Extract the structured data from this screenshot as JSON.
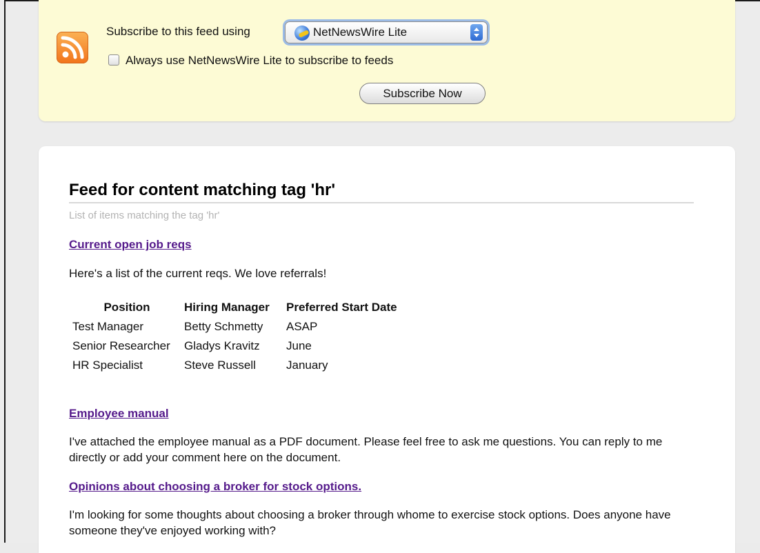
{
  "subscribe": {
    "label": "Subscribe to this feed using",
    "reader": "NetNewsWire Lite",
    "always_label": "Always use NetNewsWire Lite to subscribe to feeds",
    "always_checked": false,
    "button_label": "Subscribe Now"
  },
  "feed": {
    "title": "Feed for content matching tag 'hr'",
    "subtitle": "List of items matching the tag 'hr'",
    "items": [
      {
        "title": "Current open job reqs",
        "text": "Here's a list of the current reqs. We love referrals!"
      },
      {
        "title": "Employee manual",
        "text": "I've attached the employee manual as a PDF document. Please feel free to ask me questions. You can reply to me directly or add your comment here on the document."
      },
      {
        "title": "Opinions about choosing a broker for stock options.",
        "text": "I'm looking for some thoughts about choosing a broker through whome to exercise stock options. Does anyone have someone they've enjoyed working with?"
      }
    ],
    "table": {
      "headers": [
        "Position",
        "Hiring Manager",
        "Preferred Start Date"
      ],
      "rows": [
        [
          "Test Manager",
          "Betty Schmetty",
          "ASAP"
        ],
        [
          "Senior Researcher",
          "Gladys Kravitz",
          "June"
        ],
        [
          "HR Specialist",
          "Steve Russell",
          "January"
        ]
      ]
    }
  },
  "colors": {
    "subscribe_bg": "#fdfbd5",
    "visited_link": "#551a8b",
    "rss_orange": "#f1731b"
  }
}
